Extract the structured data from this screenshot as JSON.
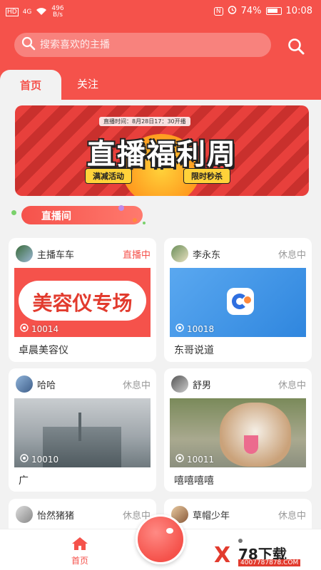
{
  "statusbar": {
    "carrier": "HD",
    "signal": "4G",
    "net_speed_value": "496",
    "net_speed_unit": "B/s",
    "battery": "74%",
    "time": "10:08"
  },
  "search": {
    "placeholder": "搜索喜欢的主播"
  },
  "tabs": [
    {
      "label": "首页",
      "active": true
    },
    {
      "label": "关注",
      "active": false
    }
  ],
  "banner": {
    "time_text": "直播时间：8月28日17：30开播",
    "title": "直播福利周",
    "pill_left": "满减活动",
    "pill_right": "限时秒杀"
  },
  "section_title": "直播间",
  "rooms": [
    {
      "streamer": "主播车车",
      "status": "直播中",
      "live": true,
      "room_id": "10014",
      "title": "卓晨美容仪",
      "cover_text": "美容仪专场"
    },
    {
      "streamer": "李永东",
      "status": "休息中",
      "live": false,
      "room_id": "10018",
      "title": "东哥说道"
    },
    {
      "streamer": "哈哈",
      "status": "休息中",
      "live": false,
      "room_id": "10010",
      "title": "广"
    },
    {
      "streamer": "舒男",
      "status": "休息中",
      "live": false,
      "room_id": "10011",
      "title": "嘻嘻嘻嘻"
    },
    {
      "streamer": "怡然猪猪",
      "status": "休息中",
      "live": false
    },
    {
      "streamer": "草帽少年",
      "status": "休息中",
      "live": false
    }
  ],
  "bottom_nav": {
    "home_label": "首页"
  },
  "watermark": {
    "text": "78下载",
    "url": "4007787878.COM"
  },
  "colors": {
    "primary": "#f5524b",
    "background": "#f2f2f2"
  }
}
